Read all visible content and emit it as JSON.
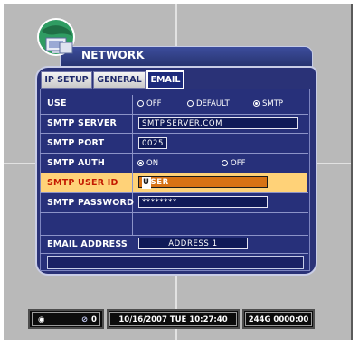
{
  "window": {
    "title": "NETWORK"
  },
  "tabs": [
    {
      "label": "IP SETUP",
      "active": false
    },
    {
      "label": "GENERAL",
      "active": false
    },
    {
      "label": "EMAIL",
      "active": true
    }
  ],
  "form": {
    "use": {
      "label": "USE",
      "options": [
        "OFF",
        "DEFAULT",
        "SMTP"
      ],
      "selected": "SMTP"
    },
    "smtp_server": {
      "label": "SMTP SERVER",
      "value": "SMTP.SERVER.COM"
    },
    "smtp_port": {
      "label": "SMTP PORT",
      "value": "0025"
    },
    "smtp_auth": {
      "label": "SMTP AUTH",
      "options": [
        "ON",
        "OFF"
      ],
      "selected": "ON"
    },
    "smtp_user_id": {
      "label": "SMTP USER ID",
      "value_cursor": "U",
      "value_rest": "SER"
    },
    "smtp_password": {
      "label": "SMTP PASSWORD",
      "value": "********"
    },
    "email_address": {
      "label": "EMAIL ADDRESS",
      "value": "ADDRESS 1"
    }
  },
  "status_bar": {
    "channel_count": "0",
    "date": "10/16/2007",
    "day": "TUE",
    "time": "10:27:40",
    "storage": "244G",
    "counter": "0000:00"
  },
  "colors": {
    "panel": "#2a3277",
    "highlight_row": "#ffd278",
    "highlight_label": "#c31a00",
    "active_field": "#d77214"
  }
}
